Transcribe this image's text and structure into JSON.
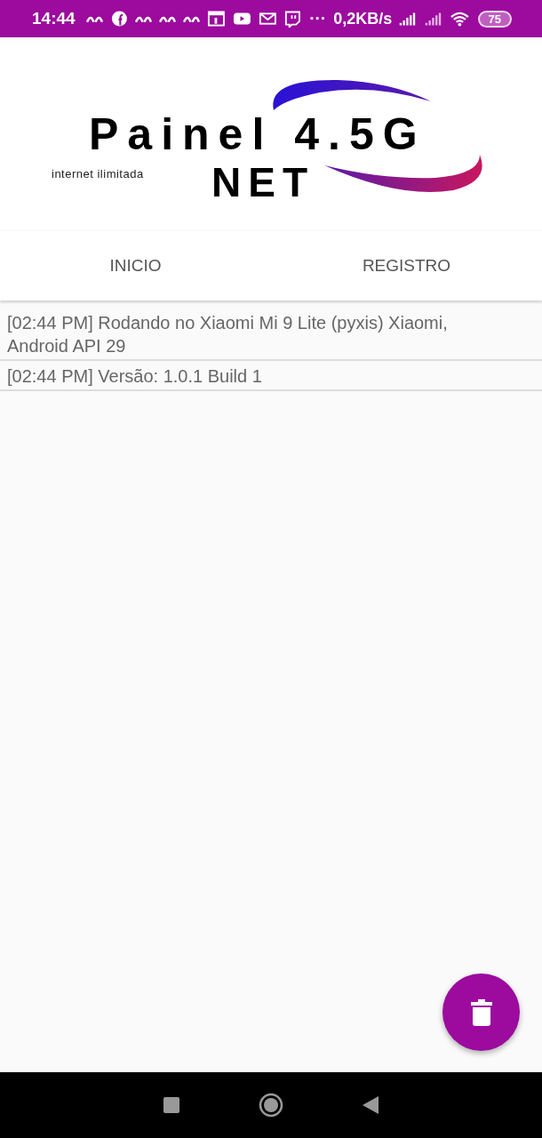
{
  "status_bar": {
    "time": "14:44",
    "more": "···",
    "speed": "0,2KB/s",
    "battery": "75"
  },
  "logo": {
    "title": "Painel 4.5G",
    "subtitle": "NET",
    "tagline": "internet ilimitada"
  },
  "tabs": [
    {
      "label": "INICIO"
    },
    {
      "label": "REGISTRO"
    }
  ],
  "log": [
    {
      "text": "[02:44 PM] Rodando no Xiaomi Mi 9 Lite (pyxis) Xiaomi, Android API 29"
    },
    {
      "text": "[02:44 PM] Versão: 1.0.1 Build 1"
    }
  ]
}
